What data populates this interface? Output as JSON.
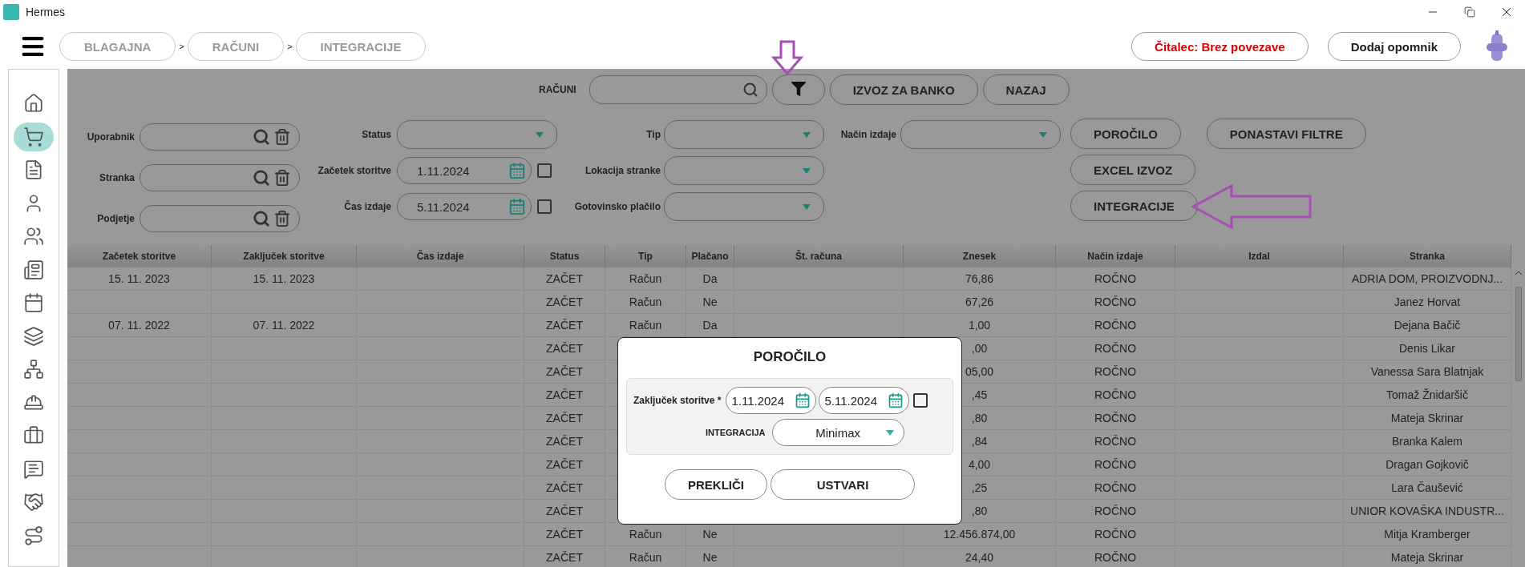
{
  "window": {
    "title": "Hermes"
  },
  "breadcrumbs": [
    {
      "label": "BLAGAJNA"
    },
    {
      "label": "RAČUNI"
    },
    {
      "label": "INTEGRACIJE"
    }
  ],
  "breadcrumb_separators": [
    ">",
    ">"
  ],
  "header_buttons": [
    {
      "label": "Čitalec: Brez povezave",
      "kind": "alert"
    },
    {
      "label": "Dodaj opomnik",
      "kind": "normal"
    }
  ],
  "sidebar": {
    "items": [
      {
        "selected": false
      },
      {
        "selected": true
      },
      {
        "selected": false
      },
      {
        "selected": false
      },
      {
        "selected": false
      },
      {
        "selected": false
      },
      {
        "selected": false
      },
      {
        "selected": false
      },
      {
        "selected": false
      },
      {
        "selected": false
      },
      {
        "selected": false
      },
      {
        "selected": false
      },
      {
        "selected": false
      },
      {
        "selected": false
      }
    ]
  },
  "toolbar": {
    "search_label": "RAČUNI",
    "buttons": [
      "IZVOZ ZA BANKO",
      "NAZAJ"
    ]
  },
  "filters": {
    "lookups": [
      {
        "label": "Uporabnik"
      },
      {
        "label": "Stranka"
      },
      {
        "label": "Podjetje"
      }
    ],
    "status": {
      "label": "Status"
    },
    "dates": [
      {
        "label": "Začetek storitve",
        "value": "1.11.2024",
        "checked": false
      },
      {
        "label": "Čas izdaje",
        "value": "5.11.2024",
        "checked": false
      }
    ],
    "selects": [
      {
        "label": "Tip"
      },
      {
        "label": "Lokacija stranke"
      },
      {
        "label": "Gotovinsko plačilo"
      }
    ],
    "method": {
      "label": "Način izdaje"
    },
    "action_buttons": [
      "POROČILO",
      "EXCEL IZVOZ",
      "INTEGRACIJE"
    ],
    "reset_button": "PONASTAVI FILTRE"
  },
  "table": {
    "columns": [
      "Začetek storitve",
      "Zaključek storitve",
      "Čas izdaje",
      "Status",
      "Tip",
      "Plačano",
      "Št. računa",
      "Znesek",
      "Način izdaje",
      "Izdal",
      "Stranka"
    ],
    "rows": [
      {
        "zacetek_storitve": "15. 11. 2023",
        "zakljucek_storitve": "15. 11. 2023",
        "status": "ZAČET",
        "tip": "Račun",
        "placano": "Da",
        "znesek": "76,86",
        "nacin_izdaje": "ROČNO",
        "stranka": "ADRIA DOM, PROIZVODNJ..."
      },
      {
        "status": "ZAČET",
        "tip": "Račun",
        "placano": "Ne",
        "znesek": "67,26",
        "nacin_izdaje": "ROČNO",
        "stranka": "Janez Horvat"
      },
      {
        "zacetek_storitve": "07. 11. 2022",
        "zakljucek_storitve": "07. 11. 2022",
        "status": "ZAČET",
        "tip": "Račun",
        "placano": "Da",
        "znesek": "1,00",
        "nacin_izdaje": "ROČNO",
        "stranka": "Dejana Bačič"
      },
      {
        "status": "ZAČET",
        "znesek": ",00",
        "nacin_izdaje": "ROČNO",
        "stranka": "Denis Likar"
      },
      {
        "status": "ZAČET",
        "znesek": "05,00",
        "nacin_izdaje": "ROČNO",
        "stranka": "Vanessa Sara Blatnjak"
      },
      {
        "status": "ZAČET",
        "znesek": ",45",
        "nacin_izdaje": "ROČNO",
        "stranka": "Tomaž Žnidaršič"
      },
      {
        "status": "ZAČET",
        "znesek": ",80",
        "nacin_izdaje": "ROČNO",
        "stranka": "Mateja Skrinar"
      },
      {
        "status": "ZAČET",
        "znesek": ",84",
        "nacin_izdaje": "ROČNO",
        "stranka": "Branka Kalem"
      },
      {
        "status": "ZAČET",
        "znesek": "4,00",
        "nacin_izdaje": "ROČNO",
        "stranka": "Dragan Gojkovič"
      },
      {
        "status": "ZAČET",
        "znesek": ",25",
        "nacin_izdaje": "ROČNO",
        "stranka": "Lara Čaušević"
      },
      {
        "status": "ZAČET",
        "znesek": ",80",
        "nacin_izdaje": "ROČNO",
        "stranka": "UNIOR KOVAŠKA INDUSTR..."
      },
      {
        "status": "ZAČET",
        "tip": "Račun",
        "placano": "Ne",
        "znesek": "12.456.874,00",
        "nacin_izdaje": "ROČNO",
        "stranka": "Mitja Kramberger"
      },
      {
        "status": "ZAČET",
        "tip": "Račun",
        "placano": "Ne",
        "znesek": "24,40",
        "nacin_izdaje": "ROČNO",
        "stranka": "Mateja Skrinar"
      }
    ]
  },
  "dialog": {
    "title": "POROČILO",
    "date_label": "Zaključek storitve *",
    "dates": [
      "1.11.2024",
      "5.11.2024"
    ],
    "checked": false,
    "integration": {
      "label": "INTEGRACIJA",
      "value": "Minimax"
    },
    "buttons": [
      "PREKLIČI",
      "USTVARI"
    ]
  }
}
